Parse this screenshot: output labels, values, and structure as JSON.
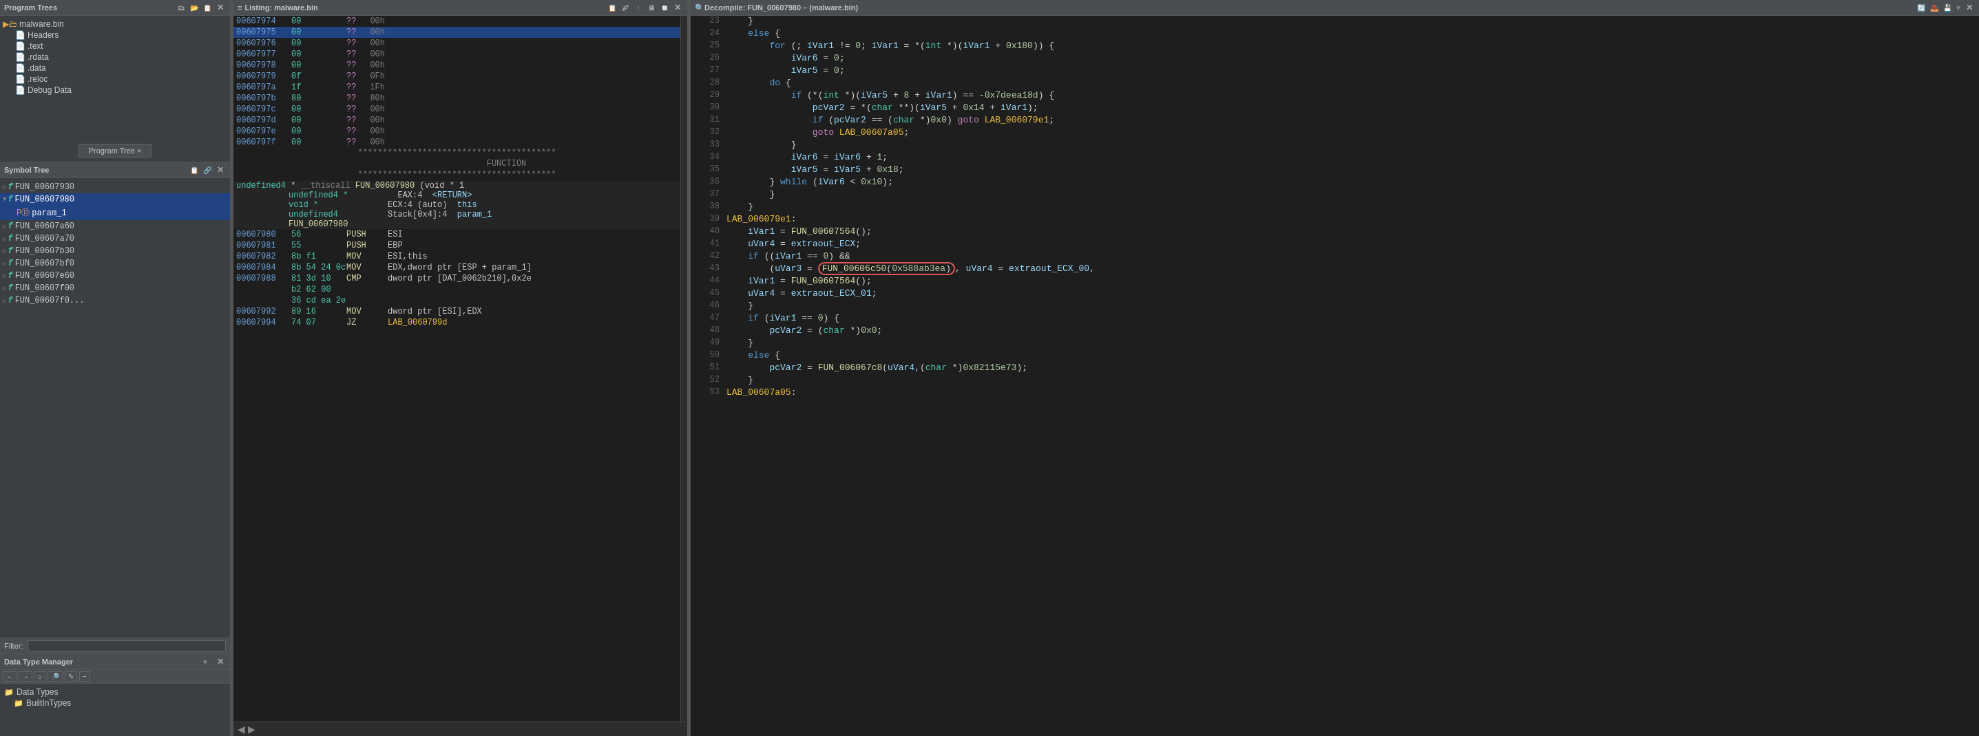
{
  "leftPanel": {
    "programTrees": {
      "title": "Program Trees",
      "items": [
        {
          "label": "malware.bin",
          "indent": 0,
          "type": "root",
          "icon": "▶"
        },
        {
          "label": "Headers",
          "indent": 1,
          "type": "file",
          "icon": "📄"
        },
        {
          "label": ".text",
          "indent": 1,
          "type": "file",
          "icon": "📄"
        },
        {
          "label": ".rdata",
          "indent": 1,
          "type": "file",
          "icon": "📄"
        },
        {
          "label": ".data",
          "indent": 1,
          "type": "file",
          "icon": "📄"
        },
        {
          "label": ".reloc",
          "indent": 1,
          "type": "file",
          "icon": "📄"
        },
        {
          "label": "Debug Data",
          "indent": 1,
          "type": "file",
          "icon": "📄"
        }
      ],
      "btnLabel": "Program Tree ×"
    },
    "symbolTree": {
      "title": "Symbol Tree",
      "items": [
        {
          "label": "FUN_00607930",
          "indent": 1,
          "selected": false
        },
        {
          "label": "FUN_00607980",
          "indent": 1,
          "selected": true
        },
        {
          "label": "param_1",
          "indent": 2,
          "isParam": true
        },
        {
          "label": "FUN_00607a60",
          "indent": 1,
          "selected": false
        },
        {
          "label": "FUN_00607a70",
          "indent": 1,
          "selected": false
        },
        {
          "label": "FUN_00607b30",
          "indent": 1,
          "selected": false
        },
        {
          "label": "FUN_00607bf0",
          "indent": 1,
          "selected": false
        },
        {
          "label": "FUN_00607e60",
          "indent": 1,
          "selected": false
        },
        {
          "label": "FUN_00607f00",
          "indent": 1,
          "selected": false
        },
        {
          "label": "FUN_00607f0...",
          "indent": 1,
          "selected": false
        }
      ],
      "filterLabel": "Filter:",
      "filterValue": ""
    },
    "dataTypeManager": {
      "title": "Data Type Manager",
      "items": [
        {
          "label": "Data Types",
          "indent": 0,
          "icon": "▶"
        },
        {
          "label": "BuiltInTypes",
          "indent": 1,
          "icon": "📁"
        }
      ]
    }
  },
  "listingPanel": {
    "title": "Listing:  malware.bin",
    "rows": [
      {
        "addr": "00607974",
        "byte": "00",
        "unk": "??",
        "val": "00h"
      },
      {
        "addr": "00607975",
        "byte": "00",
        "unk": "??",
        "val": "00h",
        "colored": true
      },
      {
        "addr": "00607976",
        "byte": "00",
        "unk": "??",
        "val": "00h"
      },
      {
        "addr": "00607977",
        "byte": "00",
        "unk": "??",
        "val": "00h"
      },
      {
        "addr": "00607978",
        "byte": "00",
        "unk": "??",
        "val": "00h"
      },
      {
        "addr": "00607979",
        "byte": "0f",
        "unk": "??",
        "val": "0Fh"
      },
      {
        "addr": "0060797a",
        "byte": "1f",
        "unk": "??",
        "val": "1Fh"
      },
      {
        "addr": "0060797b",
        "byte": "80",
        "unk": "??",
        "val": "80h"
      },
      {
        "addr": "0060797c",
        "byte": "00",
        "unk": "??",
        "val": "00h"
      },
      {
        "addr": "0060797d",
        "byte": "00",
        "unk": "??",
        "val": "00h"
      },
      {
        "addr": "0060797e",
        "byte": "00",
        "unk": "??",
        "val": "00h"
      },
      {
        "addr": "0060797f",
        "byte": "00",
        "unk": "??",
        "val": "00h"
      }
    ],
    "funcSeparator": "****************************************",
    "funcLabel": "FUNCTION",
    "funcDecl": "undefined4 * __thiscall FUN_00607980(void * 1",
    "params": [
      {
        "type": "undefined4 *",
        "reg": "EAX:4",
        "name": "<RETURN>"
      },
      {
        "type": "void *",
        "reg": "ECX:4 (auto)",
        "name": "this"
      },
      {
        "type": "undefined4",
        "reg": "Stack[0x4]:4",
        "name": "param_1"
      },
      {
        "name": "FUN_00607980"
      }
    ],
    "asmRows": [
      {
        "addr": "00607980",
        "bytes": "56",
        "mnem": "PUSH",
        "ops": "ESI"
      },
      {
        "addr": "00607981",
        "bytes": "55",
        "mnem": "PUSH",
        "ops": "EBP"
      },
      {
        "addr": "00607982",
        "bytes": "8b f1",
        "mnem": "MOV",
        "ops": "ESI,this"
      },
      {
        "addr": "00607984",
        "bytes": "8b 54 24 0c",
        "mnem": "MOV",
        "ops": "EDX,dword ptr [ESP + param_1]"
      },
      {
        "addr": "00607988",
        "bytes": "81 3d 10",
        "mnem": "CMP",
        "ops": "dword ptr [DAT_0062b210],0x2e"
      },
      {
        "addr": "",
        "bytes": "b2 62 00",
        "mnem": "",
        "ops": ""
      },
      {
        "addr": "",
        "bytes": "36 cd ea 2e",
        "mnem": "",
        "ops": ""
      },
      {
        "addr": "00607992",
        "bytes": "89 16",
        "mnem": "MOV",
        "ops": "dword ptr [ESI],EDX"
      },
      {
        "addr": "00607994",
        "bytes": "74 07",
        "mnem": "JZ",
        "ops": "LAB_0060799d"
      }
    ]
  },
  "decompilePanel": {
    "title": "Decompile: FUN_00607980 – (malware.bin)",
    "lines": [
      {
        "num": 23,
        "text": "    }"
      },
      {
        "num": 24,
        "text": "    else {"
      },
      {
        "num": 25,
        "text": "        for (; iVar1 != 0; iVar1 = *(int *)(iVar1 + 0x180)) {"
      },
      {
        "num": 26,
        "text": "            iVar6 = 0;"
      },
      {
        "num": 27,
        "text": "            iVar5 = 0;"
      },
      {
        "num": 28,
        "text": "        do {"
      },
      {
        "num": 29,
        "text": "            if (*(int *)(iVar5 + 8 + iVar1) == -0x7deea18d) {"
      },
      {
        "num": 30,
        "text": "                pcVar2 = *(char **)(iVar5 + 0x14 + iVar1);"
      },
      {
        "num": 31,
        "text": "                if (pcVar2 == (char *)0x0) goto LAB_006079e1;"
      },
      {
        "num": 32,
        "text": "                goto LAB_00607a05;"
      },
      {
        "num": 33,
        "text": "            }"
      },
      {
        "num": 34,
        "text": "            iVar6 = iVar6 + 1;"
      },
      {
        "num": 35,
        "text": "            iVar5 = iVar5 + 0x18;"
      },
      {
        "num": 36,
        "text": "        } while (iVar6 < 0x10);"
      },
      {
        "num": 37,
        "text": "        }"
      },
      {
        "num": 38,
        "text": "    }"
      },
      {
        "num": 39,
        "text": "LAB_006079e1:"
      },
      {
        "num": 40,
        "text": "    iVar1 = FUN_00607564();"
      },
      {
        "num": 41,
        "text": "    uVar4 = extraout_ECX;"
      },
      {
        "num": 42,
        "text": "    if ((iVar1 == 0) &&"
      },
      {
        "num": 43,
        "text": "        (uVar3 = FUN_00606c50(0x588ab3ea), uVar4 = extraout_ECX_00,"
      },
      {
        "num": 44,
        "text": "    iVar1 = FUN_00607564();"
      },
      {
        "num": 45,
        "text": "    uVar4 = extraout_ECX_01;"
      },
      {
        "num": 46,
        "text": "    }"
      },
      {
        "num": 47,
        "text": "    if (iVar1 == 0) {"
      },
      {
        "num": 48,
        "text": "        pcVar2 = (char *)0x0;"
      },
      {
        "num": 49,
        "text": "    }"
      },
      {
        "num": 50,
        "text": "    else {"
      },
      {
        "num": 51,
        "text": "        pcVar2 = FUN_006067c8(uVar4,(char *)0x82115e73);"
      },
      {
        "num": 52,
        "text": "    }"
      },
      {
        "num": 53,
        "text": "LAB_00607a05:"
      }
    ]
  }
}
